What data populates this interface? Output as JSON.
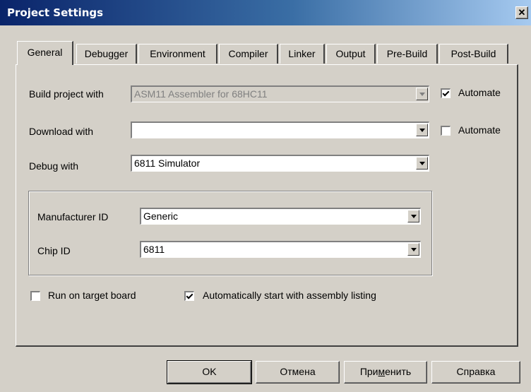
{
  "window": {
    "title": "Project Settings",
    "close_glyph": "✕"
  },
  "tabs": [
    {
      "label": "General",
      "active": true
    },
    {
      "label": "Debugger"
    },
    {
      "label": "Environment"
    },
    {
      "label": "Compiler"
    },
    {
      "label": "Linker"
    },
    {
      "label": "Output"
    },
    {
      "label": "Pre-Build"
    },
    {
      "label": "Post-Build"
    }
  ],
  "general": {
    "build_label": "Build project with",
    "build_value": "ASM11 Assembler for 68HC11",
    "build_automate_label": "Automate",
    "build_automate_checked": true,
    "download_label": "Download with",
    "download_value": "",
    "download_automate_label": "Automate",
    "download_automate_checked": false,
    "debug_label": "Debug with",
    "debug_value": "6811 Simulator",
    "manufacturer_label": "Manufacturer ID",
    "manufacturer_value": "Generic",
    "chip_label": "Chip ID",
    "chip_value": "6811",
    "run_on_target_label": "Run on target board",
    "run_on_target_checked": false,
    "auto_start_label": "Automatically start with assembly listing",
    "auto_start_checked": true
  },
  "buttons": {
    "ok": "OK",
    "cancel": "Отмена",
    "apply_pre": "При",
    "apply_u": "м",
    "apply_post": "енить",
    "help": "Справка"
  }
}
